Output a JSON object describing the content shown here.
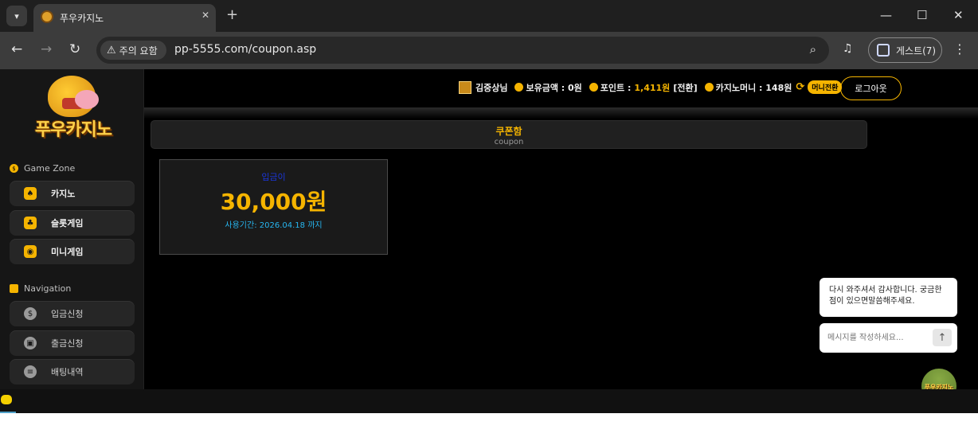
{
  "browser": {
    "tab_title": "푸우카지노",
    "security_label": "주의 요함",
    "url": "pp-5555.com/coupon.asp",
    "profile_label": "게스트(7)"
  },
  "site": {
    "logo_text": "푸우카지노"
  },
  "sidebar": {
    "game_zone_title": "Game Zone",
    "game_items": [
      {
        "label": "카지노"
      },
      {
        "label": "슬롯게임"
      },
      {
        "label": "미니게임"
      }
    ],
    "navigation_title": "Navigation",
    "nav_items": [
      {
        "label": "입금신청"
      },
      {
        "label": "출금신청"
      },
      {
        "label": "배팅내역"
      }
    ]
  },
  "header": {
    "username": "김중상님",
    "balance_label": "보유금액 : 0원",
    "point_label": "포인트 :",
    "point_value": "1,411원",
    "point_convert": "[전환]",
    "casino_money_label": "카지노머니 : 148원",
    "money_convert_button": "머니전환",
    "logout_button": "로그아웃"
  },
  "coupon_page": {
    "title": "쿠폰함",
    "subtitle": "coupon",
    "coupons": [
      {
        "title": "입금이",
        "amount": "30,000원",
        "period": "사용기간: 2026.04.18 까지"
      }
    ]
  },
  "chat": {
    "message": "다시 와주셔서 감사합니다. 궁금한점이 있으면말씀해주세요.",
    "input_placeholder": "메시지를 작성하세요...",
    "avatar_text": "푸우카지노"
  },
  "colors": {
    "accent": "#f5b400",
    "coupon_period": "#27b6f0",
    "coupon_title": "#1a35d8"
  }
}
